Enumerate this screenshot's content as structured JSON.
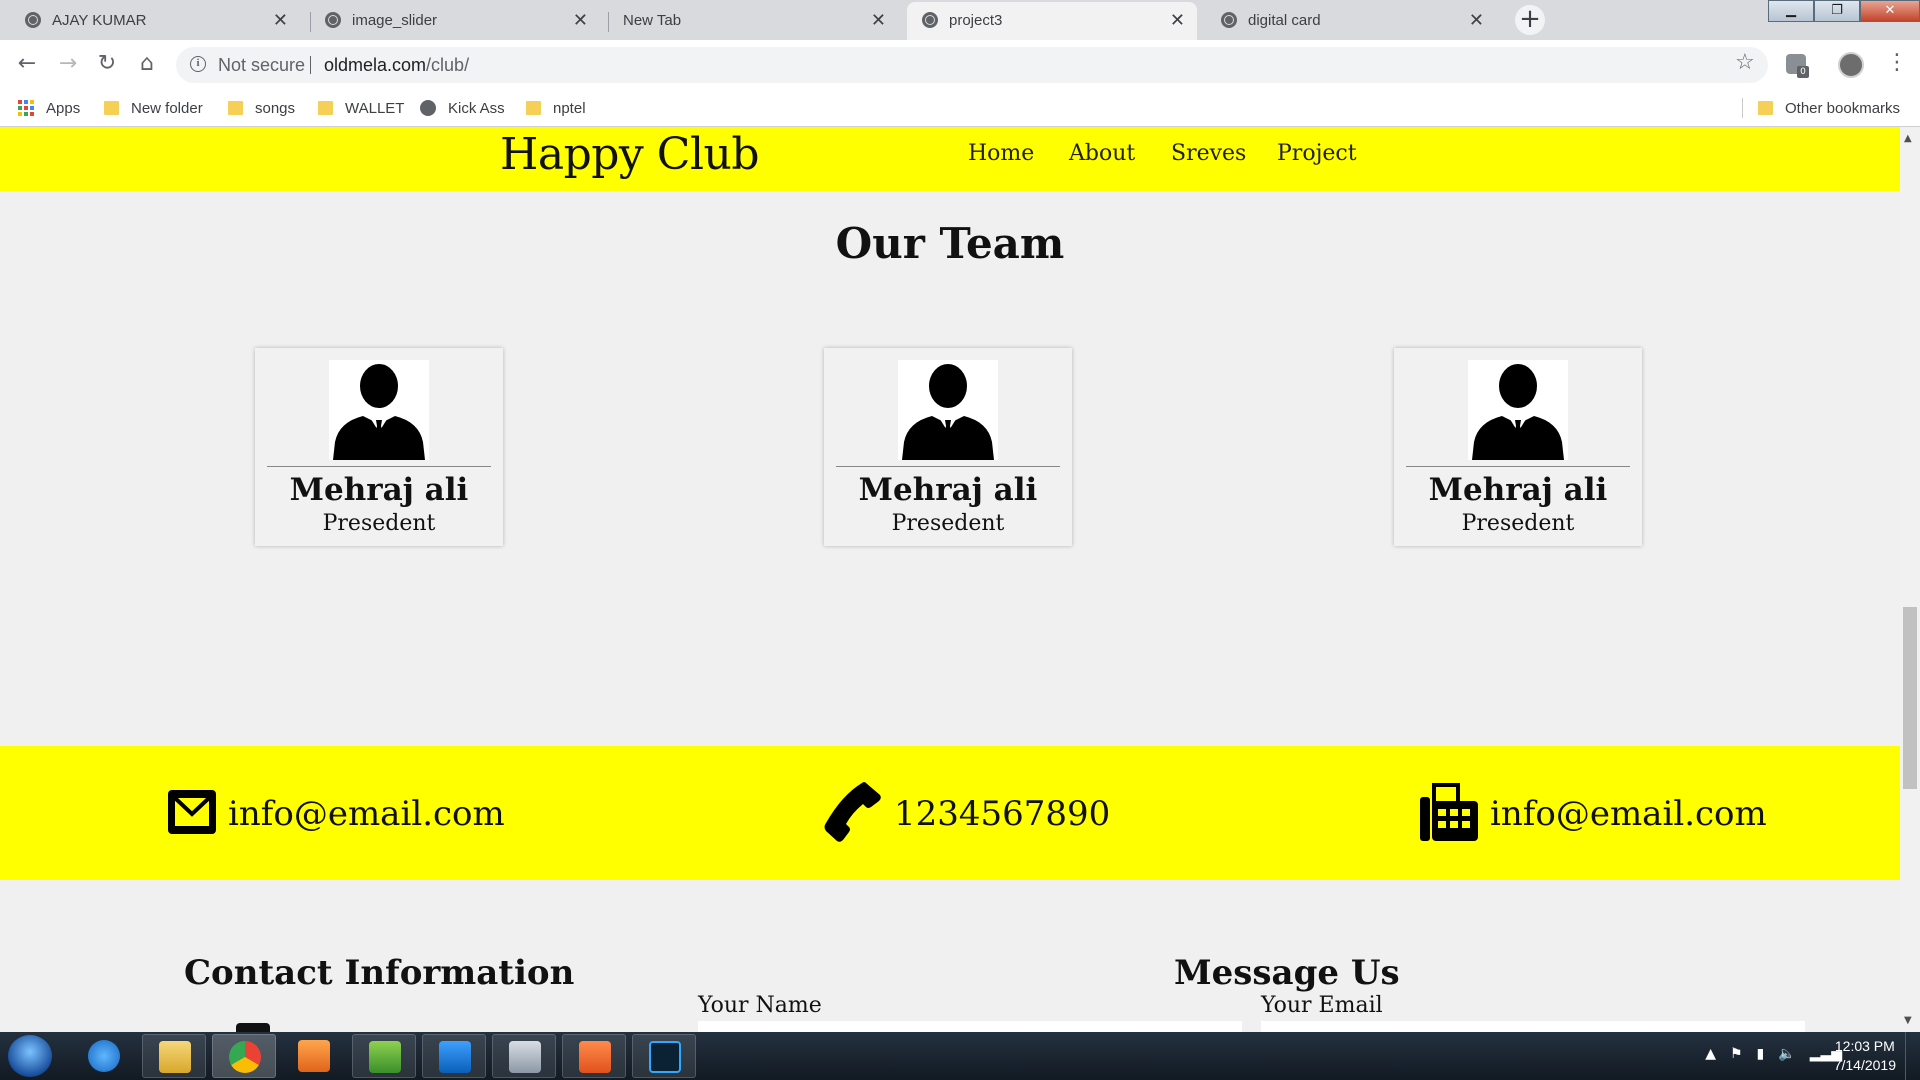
{
  "browser": {
    "tabs": [
      {
        "title": "AJAY KUMAR",
        "active": false
      },
      {
        "title": "image_slider",
        "active": false
      },
      {
        "title": "New Tab",
        "active": false
      },
      {
        "title": "project3",
        "active": true
      },
      {
        "title": "digital card",
        "active": false
      }
    ],
    "newtab_label": "+",
    "security_label": "Not secure",
    "url_domain": "oldmela.com",
    "url_path": "/club/",
    "extension_badge": "0",
    "bookmarks": [
      "Apps",
      "New folder",
      "songs",
      "WALLET",
      "Kick Ass",
      "nptel"
    ],
    "other_bookmarks": "Other bookmarks"
  },
  "site": {
    "brand": "Happy Club",
    "nav": [
      "Home",
      "About",
      "Sreves",
      "Project"
    ],
    "team_title": "Our Team",
    "members": [
      {
        "name": "Mehraj ali",
        "role": "Presedent"
      },
      {
        "name": "Mehraj ali",
        "role": "Presedent"
      },
      {
        "name": "Mehraj ali",
        "role": "Presedent"
      }
    ],
    "contacts": {
      "email": "info@email.com",
      "phone": "1234567890",
      "fax": "info@email.com"
    },
    "contact_info_title": "Contact Information",
    "message_title": "Message Us",
    "form": {
      "name_label": "Your Name",
      "email_label": "Your Email"
    }
  },
  "taskbar": {
    "time": "12:03 PM",
    "date": "7/14/2019"
  },
  "colors": {
    "header_bg": "#ffff00",
    "page_bg": "#f0f0f0",
    "chrome_tabstrip": "#d8dadd",
    "taskbar": "#1b2530"
  }
}
